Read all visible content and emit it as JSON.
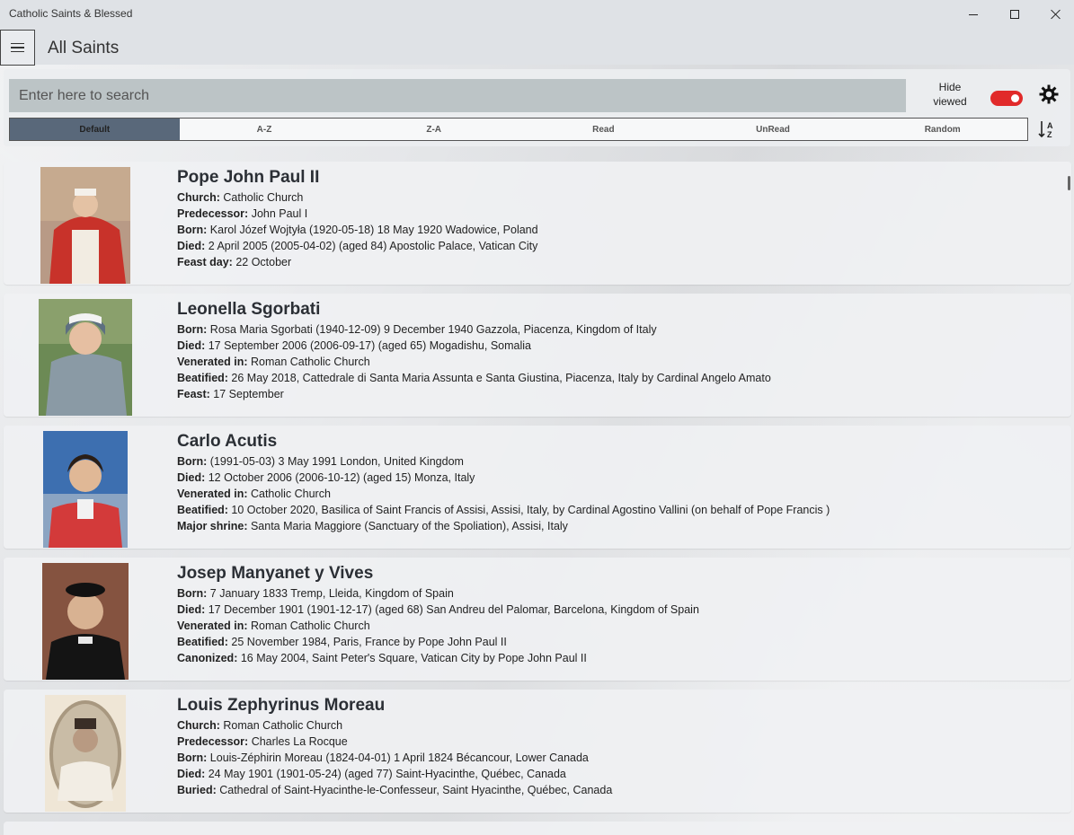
{
  "window": {
    "title": "Catholic Saints & Blessed"
  },
  "header": {
    "title": "All Saints"
  },
  "search": {
    "placeholder": "Enter here to search"
  },
  "hide_viewed": {
    "label_line1": "Hide",
    "label_line2": "viewed",
    "on": true
  },
  "sort_options": [
    "Default",
    "A-Z",
    "Z-A",
    "Read",
    "UnRead",
    "Random"
  ],
  "sort_selected": "Default",
  "colors": {
    "toggle_on": "#e12a2a",
    "sort_active": "#59687a",
    "search_bg": "#bcc4c6"
  },
  "saints": [
    {
      "name": "Pope John Paul II",
      "fields": [
        {
          "label": "Church:",
          "value": " Catholic Church"
        },
        {
          "label": "Predecessor:",
          "value": " John Paul I"
        },
        {
          "label": "Born:",
          "value": " Karol Józef Wojtyła (1920-05-18) 18 May 1920 Wadowice, Poland"
        },
        {
          "label": "Died:",
          "value": " 2 April 2005 (2005-04-02) (aged 84) Apostolic Palace, Vatican City"
        },
        {
          "label": "Feast day:",
          "value": " 22 October"
        }
      ]
    },
    {
      "name": "Leonella Sgorbati",
      "fields": [
        {
          "label": "Born:",
          "value": " Rosa Maria Sgorbati (1940-12-09) 9 December 1940 Gazzola, Piacenza, Kingdom of Italy"
        },
        {
          "label": "Died:",
          "value": " 17 September 2006 (2006-09-17) (aged 65) Mogadishu, Somalia"
        },
        {
          "label": "Venerated in:",
          "value": " Roman Catholic Church"
        },
        {
          "label": "Beatified:",
          "value": " 26 May 2018, Cattedrale di Santa Maria Assunta e Santa Giustina, Piacenza, Italy by Cardinal Angelo Amato"
        },
        {
          "label": "Feast:",
          "value": " 17 September"
        }
      ]
    },
    {
      "name": "Carlo Acutis",
      "fields": [
        {
          "label": "Born:",
          "value": " (1991-05-03) 3 May 1991 London, United Kingdom"
        },
        {
          "label": "Died:",
          "value": " 12 October 2006 (2006-10-12) (aged 15) Monza, Italy"
        },
        {
          "label": "Venerated in:",
          "value": " Catholic Church"
        },
        {
          "label": "Beatified:",
          "value": " 10 October 2020, Basilica of Saint Francis of Assisi, Assisi, Italy, by Cardinal Agostino Vallini (on behalf of Pope Francis )"
        },
        {
          "label": "Major shrine:",
          "value": " Santa Maria Maggiore (Sanctuary of the Spoliation), Assisi, Italy"
        }
      ]
    },
    {
      "name": "Josep Manyanet y Vives",
      "fields": [
        {
          "label": "Born:",
          "value": " 7 January 1833 Tremp, Lleida, Kingdom of Spain"
        },
        {
          "label": "Died:",
          "value": " 17 December 1901 (1901-12-17) (aged 68) San Andreu del Palomar, Barcelona, Kingdom of Spain"
        },
        {
          "label": "Venerated in:",
          "value": " Roman Catholic Church"
        },
        {
          "label": "Beatified:",
          "value": " 25 November 1984, Paris, France by Pope John Paul II"
        },
        {
          "label": "Canonized:",
          "value": " 16 May 2004, Saint Peter's Square, Vatican City by Pope John Paul II"
        }
      ]
    },
    {
      "name": "Louis Zephyrinus Moreau",
      "fields": [
        {
          "label": "Church:",
          "value": " Roman Catholic Church"
        },
        {
          "label": "Predecessor:",
          "value": " Charles La Rocque"
        },
        {
          "label": "Born:",
          "value": " Louis-Zéphirin Moreau (1824-04-01) 1 April 1824 Bécancour, Lower Canada"
        },
        {
          "label": "Died:",
          "value": " 24 May 1901 (1901-05-24) (aged 77) Saint-Hyacinthe, Québec, Canada"
        },
        {
          "label": "Buried:",
          "value": " Cathedral of Saint-Hyacinthe-le-Confesseur, Saint Hyacinthe, Québec, Canada"
        }
      ]
    }
  ]
}
